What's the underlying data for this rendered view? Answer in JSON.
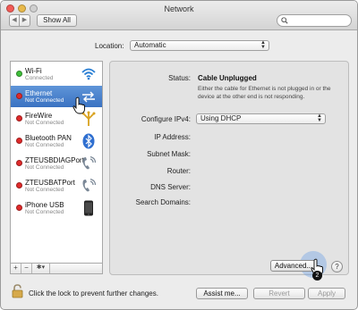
{
  "window": {
    "title": "Network"
  },
  "toolbar": {
    "back_glyph": "◀",
    "forward_glyph": "▶",
    "show_all_label": "Show All",
    "search_placeholder": ""
  },
  "location": {
    "label": "Location:",
    "value": "Automatic"
  },
  "services": [
    {
      "name": "Wi-Fi",
      "status": "Connected",
      "dot_color": "#3fbf3a",
      "icon": "wifi-icon"
    },
    {
      "name": "Ethernet",
      "status": "Not Connected",
      "dot_color": "#e02a2a",
      "icon": "ethernet-icon",
      "selected": true
    },
    {
      "name": "FireWire",
      "status": "Not Connected",
      "dot_color": "#e02a2a",
      "icon": "firewire-icon"
    },
    {
      "name": "Bluetooth PAN",
      "status": "Not Connected",
      "dot_color": "#e02a2a",
      "icon": "bluetooth-icon"
    },
    {
      "name": "ZTEUSBDIAGPort",
      "status": "Not Connected",
      "dot_color": "#e02a2a",
      "icon": "phone-modem-icon"
    },
    {
      "name": "ZTEUSBATPort",
      "status": "Not Connected",
      "dot_color": "#e02a2a",
      "icon": "phone-modem-icon"
    },
    {
      "name": "iPhone USB",
      "status": "Not Connected",
      "dot_color": "#e02a2a",
      "icon": "iphone-icon"
    }
  ],
  "sidebar_bar": {
    "add": "+",
    "remove": "−",
    "gear": "✱▾"
  },
  "details": {
    "status_label": "Status:",
    "status_value": "Cable Unplugged",
    "status_description": "Either the cable for Ethernet is not plugged in or the device at the other end is not responding.",
    "configure_label": "Configure IPv4:",
    "configure_value": "Using DHCP",
    "ip_label": "IP Address:",
    "subnet_label": "Subnet Mask:",
    "router_label": "Router:",
    "dns_label": "DNS Server:",
    "search_domains_label": "Search Domains:"
  },
  "buttons": {
    "advanced": "Advanced...",
    "help": "?",
    "assist": "Assist me...",
    "revert": "Revert",
    "apply": "Apply"
  },
  "lock": {
    "text": "Click the lock to prevent further changes."
  },
  "click_badge": "2",
  "colors": {
    "selection": "#3a72c2",
    "connected": "#3fbf3a",
    "disconnected": "#e02a2a"
  }
}
